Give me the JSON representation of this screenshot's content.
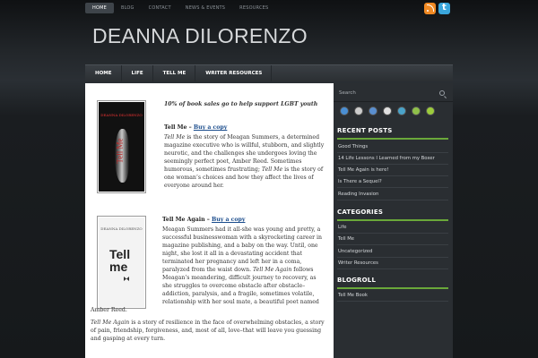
{
  "top_nav": [
    "HOME",
    "BLOG",
    "CONTACT",
    "NEWS & EVENTS",
    "RESOURCES"
  ],
  "site_title": "DEANNA DILORENZO",
  "main_nav": [
    "HOME",
    "LIFE",
    "TELL ME",
    "WRITER RESOURCES"
  ],
  "content": {
    "tagline": "10% of  book sales go to help support LGBT youth",
    "book1": {
      "title": "Tell Me – ",
      "link": "Buy a copy",
      "cover_author": "DEANNA DILORENZO",
      "cover_title": "Tell Me",
      "lines": [
        "Tell Me is the story of Meagan Summers, a determined",
        "magazine executive who is willful, stubborn, and slightly",
        "neurotic, and the challenges she undergoes loving the",
        "seemingly perfect poet, Amber Reed. Sometimes",
        "humorous, sometimes frustrating; Tell Me is the story of",
        "one woman’s choices and how they affect the lives of",
        "everyone around her."
      ]
    },
    "book2": {
      "title": "Tell Me Again – ",
      "link": "Buy a copy",
      "cover_author": "DEANNA DILORENZO",
      "cover_title": "Tell me",
      "lines": [
        "Meagan Summers had it all-she was young and pretty, a",
        "successful businesswoman with a skyrocketing career in",
        "magazine publishing, and a baby on the way. Until, one",
        "night, she lost it all in a devastating accident that",
        "terminated her pregnancy and left her in a coma,",
        "paralyzed from the waist down. Tell Me Again follows",
        "Meagan’s meandering, difficult journey to recovery, as",
        "she struggles to overcome obstacle after obstacle–",
        "addiction, paralysis, and a fragile, sometimes volatile,",
        "relationship with her soul mate, a beautiful poet named"
      ],
      "line_full": "Amber Reed.",
      "closing_lines": [
        "Tell Me Again is a story of resilience in the face of overwhelming obstacles, a story",
        "of pain, friendship, forgiveness, and, most of all, love–that will leave you guessing",
        "and gasping at every turn."
      ]
    }
  },
  "sidebar": {
    "search_placeholder": "Search",
    "icon_colors": [
      "#4a8fd4",
      "#cccccc",
      "#5a8fd0",
      "#e0e0e0",
      "#4aa3c9",
      "#8fc04a",
      "#9ccc3c"
    ],
    "recent_posts_heading": "RECENT POSTS",
    "recent_posts": [
      "Good Things",
      "14 Life Lessons I Learned from my Boxer",
      "Tell Me Again is here!",
      "Is There a Sequel?",
      "Reading Invasion"
    ],
    "categories_heading": "CATEGORIES",
    "categories": [
      "Life",
      "Tell Me",
      "Uncategorized",
      "Writer Resources"
    ],
    "blogroll_heading": "BLOGROLL",
    "blogroll": [
      "Tell Me Book"
    ]
  },
  "colors": {
    "accent_green": "#6aa83a",
    "link_blue": "#1a4c8c",
    "rss_orange": "#f08a24",
    "twitter_blue": "#3aa6dc"
  }
}
